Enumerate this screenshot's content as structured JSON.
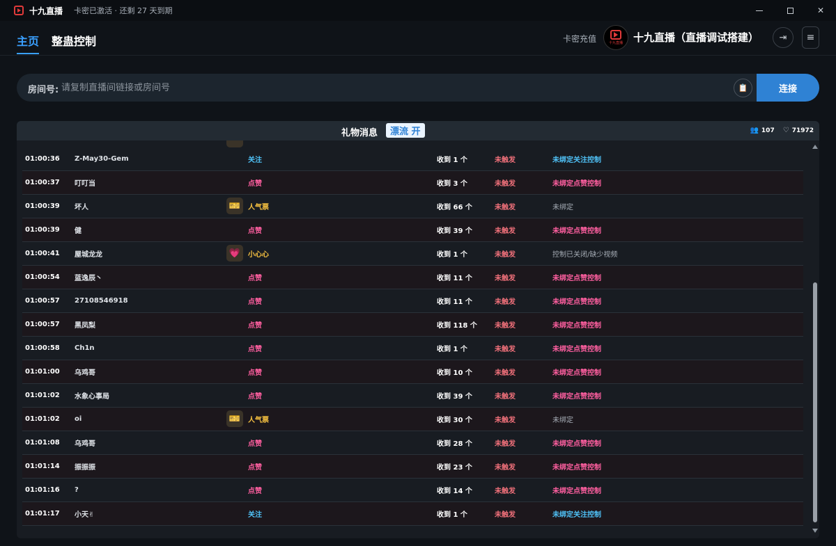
{
  "app": {
    "name": "十九直播",
    "license_status": "卡密已激活 · 还剩 27 天到期"
  },
  "nav": {
    "tabs": [
      {
        "label": "主页",
        "active": true
      },
      {
        "label": "整蛊控制",
        "active": false
      }
    ],
    "recharge_label": "卡密充值",
    "avatar_text": "十九直播",
    "account_name": "十九直播（直播调试搭建）"
  },
  "room": {
    "label": "房间号:",
    "placeholder": "请复制直播间链接或房间号",
    "value": "",
    "connect_label": "连接"
  },
  "panel": {
    "title": "礼物消息",
    "float_toggle": "漂流 开",
    "viewers": "107",
    "likes": "71972"
  },
  "colors": {
    "accent": "#2f82d4",
    "follow": "#4fc0f5",
    "like": "#ff5fa0",
    "gift": "#f5c040",
    "untriggered": "#f0707a"
  },
  "rows": [
    {
      "time": "01:00:36",
      "user": "Z-May30-Gem",
      "gift_icon": "",
      "type": "关注",
      "kind": "follow",
      "count": "收到 1 个",
      "trigger": "未触发",
      "bind": "未绑定关注控制",
      "bind_kind": "follow"
    },
    {
      "time": "01:00:37",
      "user": "叮叮当",
      "gift_icon": "",
      "type": "点赞",
      "kind": "like",
      "count": "收到 3 个",
      "trigger": "未触发",
      "bind": "未绑定点赞控制",
      "bind_kind": "like"
    },
    {
      "time": "01:00:39",
      "user": "坏人",
      "gift_icon": "ticket-icon",
      "type": "人气票",
      "kind": "gift",
      "count": "收到 66 个",
      "trigger": "未触发",
      "bind": "未绑定",
      "bind_kind": "plain"
    },
    {
      "time": "01:00:39",
      "user": "健",
      "gift_icon": "",
      "type": "点赞",
      "kind": "like",
      "count": "收到 39 个",
      "trigger": "未触发",
      "bind": "未绑定点赞控制",
      "bind_kind": "like"
    },
    {
      "time": "01:00:41",
      "user": "屋城龙龙",
      "gift_icon": "heart-icon",
      "type": "小心心",
      "kind": "gift",
      "count": "收到 1 个",
      "trigger": "未触发",
      "bind": "控制已关闭/缺少视频",
      "bind_kind": "plain"
    },
    {
      "time": "01:00:54",
      "user": "蓝逸辰丶",
      "gift_icon": "",
      "type": "点赞",
      "kind": "like",
      "count": "收到 11 个",
      "trigger": "未触发",
      "bind": "未绑定点赞控制",
      "bind_kind": "like"
    },
    {
      "time": "01:00:57",
      "user": "27108546918",
      "gift_icon": "",
      "type": "点赞",
      "kind": "like",
      "count": "收到 11 个",
      "trigger": "未触发",
      "bind": "未绑定点赞控制",
      "bind_kind": "like"
    },
    {
      "time": "01:00:57",
      "user": "黑凤梨",
      "gift_icon": "",
      "type": "点赞",
      "kind": "like",
      "count": "收到 118 个",
      "trigger": "未触发",
      "bind": "未绑定点赞控制",
      "bind_kind": "like"
    },
    {
      "time": "01:00:58",
      "user": "Ch1n",
      "gift_icon": "",
      "type": "点赞",
      "kind": "like",
      "count": "收到 1 个",
      "trigger": "未触发",
      "bind": "未绑定点赞控制",
      "bind_kind": "like"
    },
    {
      "time": "01:01:00",
      "user": "乌鸡哥",
      "gift_icon": "",
      "type": "点赞",
      "kind": "like",
      "count": "收到 10 个",
      "trigger": "未触发",
      "bind": "未绑定点赞控制",
      "bind_kind": "like"
    },
    {
      "time": "01:01:02",
      "user": "水象心事局",
      "gift_icon": "",
      "type": "点赞",
      "kind": "like",
      "count": "收到 39 个",
      "trigger": "未触发",
      "bind": "未绑定点赞控制",
      "bind_kind": "like"
    },
    {
      "time": "01:01:02",
      "user": "oi",
      "gift_icon": "ticket-icon",
      "type": "人气票",
      "kind": "gift",
      "count": "收到 30 个",
      "trigger": "未触发",
      "bind": "未绑定",
      "bind_kind": "plain"
    },
    {
      "time": "01:01:08",
      "user": "乌鸡哥",
      "gift_icon": "",
      "type": "点赞",
      "kind": "like",
      "count": "收到 28 个",
      "trigger": "未触发",
      "bind": "未绑定点赞控制",
      "bind_kind": "like"
    },
    {
      "time": "01:01:14",
      "user": "振振振",
      "gift_icon": "",
      "type": "点赞",
      "kind": "like",
      "count": "收到 23 个",
      "trigger": "未触发",
      "bind": "未绑定点赞控制",
      "bind_kind": "like"
    },
    {
      "time": "01:01:16",
      "user": "?",
      "gift_icon": "",
      "type": "点赞",
      "kind": "like",
      "count": "收到 14 个",
      "trigger": "未触发",
      "bind": "未绑定点赞控制",
      "bind_kind": "like"
    },
    {
      "time": "01:01:17",
      "user": "小天✌",
      "gift_icon": "",
      "type": "关注",
      "kind": "follow",
      "count": "收到 1 个",
      "trigger": "未触发",
      "bind": "未绑定关注控制",
      "bind_kind": "follow"
    }
  ]
}
